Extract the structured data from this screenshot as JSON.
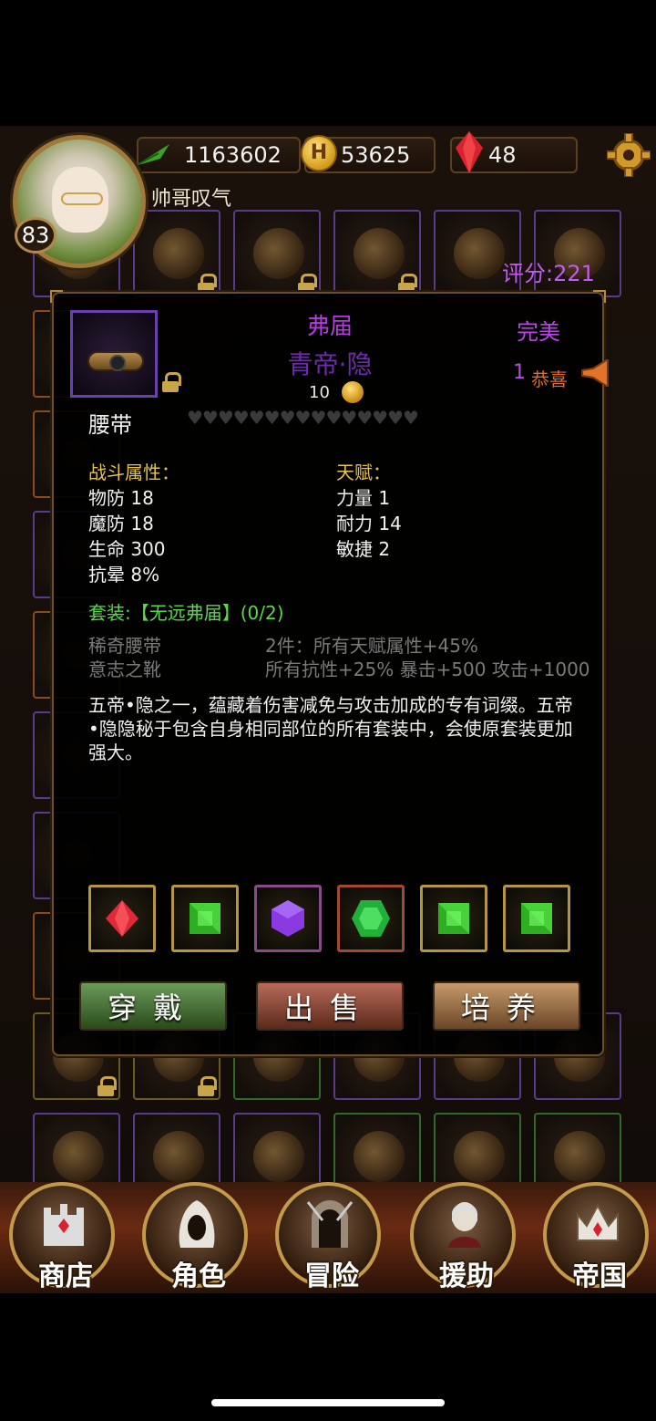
{
  "hud": {
    "level": "83",
    "power": "1163602",
    "gold": "53625",
    "gold_icon_letter": "H",
    "gems": "48",
    "player_name": "帅哥叹气"
  },
  "score": "评分:221",
  "item": {
    "prefix": "弗届",
    "name": "青帝·隐",
    "quality": "完美",
    "congrats_count": "1",
    "congrats_label": "恭喜",
    "price": "10",
    "type": "腰带",
    "hearts": "♥♥♥♥♥♥♥♥♥♥♥♥♥♥♥",
    "combat_label": "战斗属性：",
    "combat_stats": [
      "物防 18",
      "魔防 18",
      "生命 300",
      "抗晕 8%"
    ],
    "talent_label": "天赋：",
    "talent_stats": [
      "力量 1",
      "耐力 14",
      "敏捷 2"
    ],
    "set_title": "套装:【无远弗届】(0/2)",
    "set_items": [
      "稀奇腰带",
      "意志之靴"
    ],
    "set_bonuses": [
      "2件：所有天赋属性+45%",
      "所有抗性+25% 暴击+500 攻击+1000"
    ],
    "description": "五帝•隐之一，蕴藏着伤害减免与攻击加成的专有词缀。五帝•隐隐秘于包含自身相同部位的所有套装中，会使原套装更加强大。",
    "gem_slots": [
      {
        "icon": "red-gem-icon",
        "color": "#e0283a"
      },
      {
        "icon": "green-square-gem-icon",
        "color": "#3ad62a"
      },
      {
        "icon": "purple-hex-gem-icon",
        "color": "#8a3ae0"
      },
      {
        "icon": "green-hex-gem-icon",
        "color": "#2ac63a"
      },
      {
        "icon": "green-square-gem-icon",
        "color": "#3ad62a"
      },
      {
        "icon": "green-square-gem-icon",
        "color": "#3ad62a"
      }
    ]
  },
  "actions": {
    "wear": "穿戴",
    "sell": "出售",
    "train": "培养"
  },
  "nav": {
    "shop": "商店",
    "role": "角色",
    "adventure": "冒险",
    "support": "援助",
    "empire": "帝国"
  },
  "colors": {
    "accent_purple": "#b33be0",
    "gold_text": "#e7c34b",
    "set_green": "#5ad64a"
  }
}
